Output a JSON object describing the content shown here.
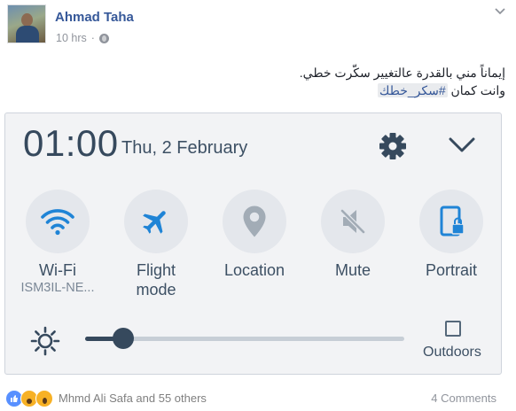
{
  "post": {
    "author": "Ahmad Taha",
    "time": "10 hrs",
    "dot": "·",
    "text_line1": "إيماناً مني بالقدرة عالتغيير سكّرت خطي.",
    "text_line2_prefix": "وانت كمان ",
    "hashtag": "#سكر_خطك",
    "options_icon": "chevron-down-icon"
  },
  "panel": {
    "time": "01:00",
    "date": "Thu, 2 February",
    "tiles": [
      {
        "label": "Wi-Fi",
        "sub": "ISM3IL-NE...",
        "icon": "wifi-icon",
        "active": true
      },
      {
        "label": "Flight",
        "label2": "mode",
        "icon": "airplane-icon",
        "active": true
      },
      {
        "label": "Location",
        "icon": "location-icon",
        "active": false
      },
      {
        "label": "Mute",
        "icon": "mute-icon",
        "active": false
      },
      {
        "label": "Portrait",
        "icon": "portrait-lock-icon",
        "active": true
      }
    ],
    "brightness_level": 0.12,
    "outdoors_label": "Outdoors",
    "outdoors_checked": false,
    "colors": {
      "active": "#1f84d6",
      "inactive": "#a2acb6",
      "text": "#3d5064"
    }
  },
  "footer": {
    "reactions": [
      "like-icon",
      "haha-icon",
      "wow-icon"
    ],
    "names": "Mhmd Ali Safa and 55 others",
    "comments": "4 Comments"
  }
}
